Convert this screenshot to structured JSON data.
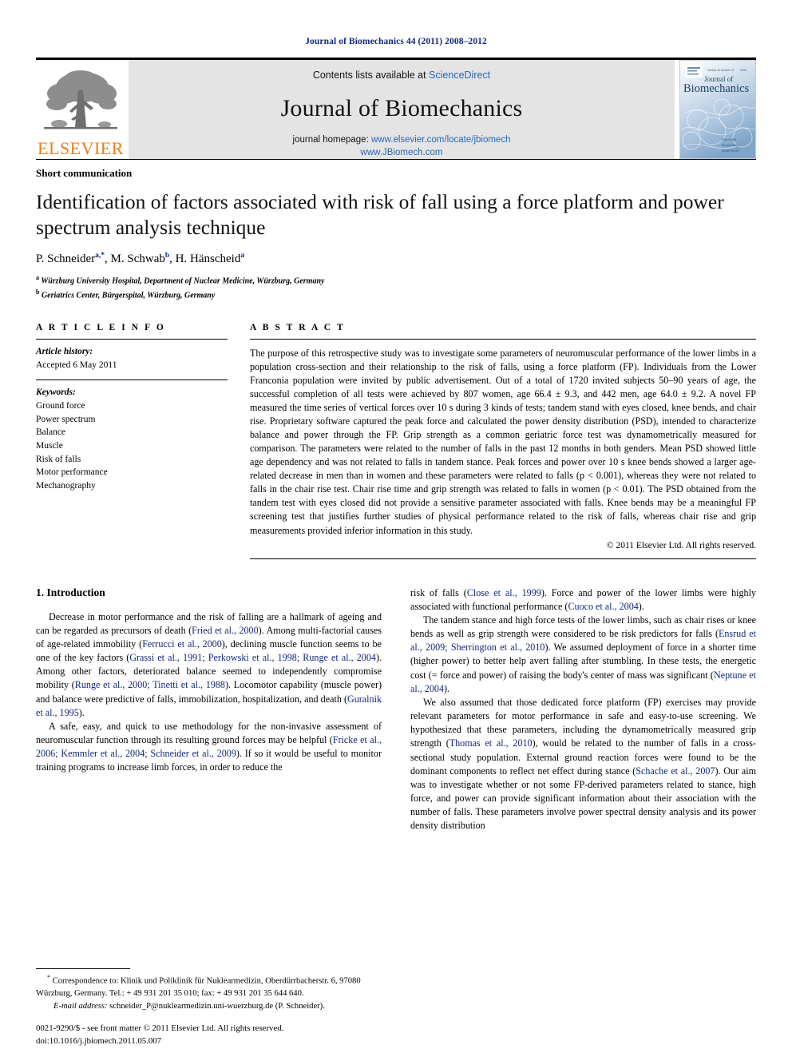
{
  "running_head": "Journal of Biomechanics 44 (2011) 2008–2012",
  "masthead": {
    "contents_prefix": "Contents lists available at ",
    "sciencedirect": "ScienceDirect",
    "journal_title": "Journal of Biomechanics",
    "homepage_prefix": "journal homepage: ",
    "homepage_url": "www.elsevier.com/locate/jbiomech",
    "homepage_url2": "www.JBiomech.com",
    "publisher": "ELSEVIER",
    "cover_title_line1": "Journal of",
    "cover_title_line2": "Biomechanics",
    "accent_blue": "#2a66b5",
    "elsevier_orange": "#f07c17",
    "banner_gray": "#e4e4e4"
  },
  "title_block": {
    "doctype": "Short communication",
    "title": "Identification of factors associated with risk of fall using a force platform and power spectrum analysis technique",
    "authors": [
      {
        "name": "P. Schneider",
        "marks": "a,*"
      },
      {
        "name": "M. Schwab",
        "marks": "b"
      },
      {
        "name": "H. Hänscheid",
        "marks": "a"
      }
    ],
    "affiliations": [
      {
        "mark": "a",
        "text": "Würzburg University Hospital, Department of Nuclear Medicine, Würzburg, Germany"
      },
      {
        "mark": "b",
        "text": "Geriatrics Center, Bürgerspital, Würzburg, Germany"
      }
    ]
  },
  "article_info": {
    "label": "A R T I C L E  I N F O",
    "history_head": "Article history:",
    "history_value": "Accepted 6 May 2011",
    "keywords_head": "Keywords:",
    "keywords": [
      "Ground force",
      "Power spectrum",
      "Balance",
      "Muscle",
      "Risk of falls",
      "Motor performance",
      "Mechanography"
    ]
  },
  "abstract": {
    "label": "A B S T R A C T",
    "text": "The purpose of this retrospective study was to investigate some parameters of neuromuscular performance of the lower limbs in a population cross-section and their relationship to the risk of falls, using a force platform (FP). Individuals from the Lower Franconia population were invited by public advertisement. Out of a total of 1720 invited subjects 50–90 years of age, the successful completion of all tests were achieved by 807 women, age 66.4 ± 9.3, and 442 men, age 64.0 ± 9.2. A novel FP measured the time series of vertical forces over 10 s during 3 kinds of tests; tandem stand with eyes closed, knee bends, and chair rise. Proprietary software captured the peak force and calculated the power density distribution (PSD), intended to characterize balance and power through the FP. Grip strength as a common geriatric force test was dynamometrically measured for comparison. The parameters were related to the number of falls in the past 12 months in both genders. Mean PSD showed little age dependency and was not related to falls in tandem stance. Peak forces and power over 10 s knee bends showed a larger age-related decrease in men than in women and these parameters were related to falls (p < 0.001), whereas they were not related to falls in the chair rise test. Chair rise time and grip strength was related to falls in women (p < 0.01). The PSD obtained from the tandem test with eyes closed did not provide a sensitive parameter associated with falls. Knee bends may be a meaningful FP screening test that justifies further studies of physical performance related to the risk of falls, whereas chair rise and grip measurements provided inferior information in this study.",
    "copyright": "© 2011 Elsevier Ltd. All rights reserved."
  },
  "introduction": {
    "heading": "1.  Introduction",
    "left_paragraphs": [
      "Decrease in motor performance and the risk of falling are a hallmark of ageing and can be regarded as precursors of death (Fried et al., 2000). Among multi-factorial causes of age-related immobility (Ferrucci et al., 2000), declining muscle function seems to be one of the key factors (Grassi et al., 1991; Perkowski et al., 1998; Runge et al., 2004). Among other factors, deteriorated balance seemed to independently compromise mobility (Runge et al., 2000; Tinetti et al., 1988). Locomotor capability (muscle power) and balance were predictive of falls, immobilization, hospitalization, and death (Guralnik et al., 1995).",
      "A safe, easy, and quick to use methodology for the non-invasive assessment of neuromuscular function through its resulting ground forces may be helpful (Fricke et al., 2006; Kemmler et al., 2004; Schneider et al., 2009). If so it would be useful to monitor training programs to increase limb forces, in order to reduce the"
    ],
    "right_paragraphs": [
      "risk of falls (Close et al., 1999). Force and power of the lower limbs were highly associated with functional performance (Cuoco et al., 2004).",
      "The tandem stance and high force tests of the lower limbs, such as chair rises or knee bends as well as grip strength were considered to be risk predictors for falls (Ensrud et al., 2009; Sherrington et al., 2010). We assumed deployment of force in a shorter time (higher power) to better help avert falling after stumbling. In these tests, the energetic cost (= force and power) of raising the body's center of mass was significant (Neptune et al., 2004).",
      "We also assumed that those dedicated force platform (FP) exercises may provide relevant parameters for motor performance in safe and easy-to-use screening. We hypothesized that these parameters, including the dynamometrically measured grip strength (Thomas et al., 2010), would be related to the number of falls in a cross-sectional study population. External ground reaction forces were found to be the dominant components to reflect net effect during stance (Schache et al., 2007). Our aim was to investigate whether or not some FP-derived parameters related to stance, high force, and power can provide significant information about their association with the number of falls. These parameters involve power spectral density analysis and its power density distribution"
    ]
  },
  "footnotes": {
    "correspondence": "Correspondence to: Klinik und Poliklinik für Nuklearmedizin, Oberdürrbacherstr. 6, 97080 Würzburg, Germany. Tel.: + 49 931 201 35 010; fax: + 49 931 201 35 644 640.",
    "email_label": "E-mail address:",
    "email": "schneider_P@nuklearmedizin.uni-wuerzburg.de (P. Schneider).",
    "imprint_line1": "0021-9290/$ - see front matter © 2011 Elsevier Ltd. All rights reserved.",
    "imprint_line2": "doi:10.1016/j.jbiomech.2011.05.007"
  }
}
